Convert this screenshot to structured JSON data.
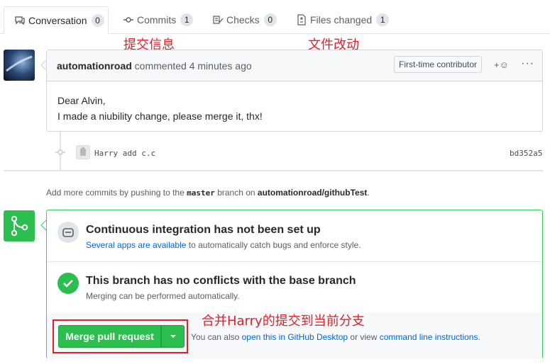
{
  "tabs": [
    {
      "label": "Conversation",
      "count": "0",
      "icon": "conversation-icon"
    },
    {
      "label": "Commits",
      "count": "1",
      "icon": "commit-icon"
    },
    {
      "label": "Checks",
      "count": "0",
      "icon": "checks-icon"
    },
    {
      "label": "Files changed",
      "count": "1",
      "icon": "file-diff-icon"
    }
  ],
  "annotations": {
    "commit_info": "提交信息",
    "file_changes": "文件改动",
    "merge_note": "合并Harry的提交到当前分支"
  },
  "comment": {
    "author": "automationroad",
    "action": "commented",
    "time": "4 minutes ago",
    "badge": "First-time contributor",
    "reaction": "+☺",
    "more": "···",
    "lines": [
      "Dear Alvin,",
      "I made a niubility change, please merge it, thx!"
    ]
  },
  "commit": {
    "message": "Harry add c.c",
    "sha": "bd352a5"
  },
  "push_hint": {
    "prefix": "Add more commits by pushing to the",
    "branch": "master",
    "middle": "branch on",
    "repo": "automationroad/githubTest",
    "suffix": "."
  },
  "merge": {
    "ci_title": "Continuous integration has not been set up",
    "ci_link": "Several apps are available",
    "ci_rest": "to automatically catch bugs and enforce style.",
    "ok_title": "This branch has no conflicts with the base branch",
    "ok_sub": "Merging can be performed automatically.",
    "button": "Merge pull request",
    "alt_prefix": "You can also",
    "alt_link1": "open this in GitHub Desktop",
    "alt_mid": "or view",
    "alt_link2": "command line instructions",
    "alt_suffix": "."
  },
  "colors": {
    "accent_green": "#2cbe4e",
    "link_blue": "#0366d6",
    "annotation_red": "#e0202a"
  }
}
